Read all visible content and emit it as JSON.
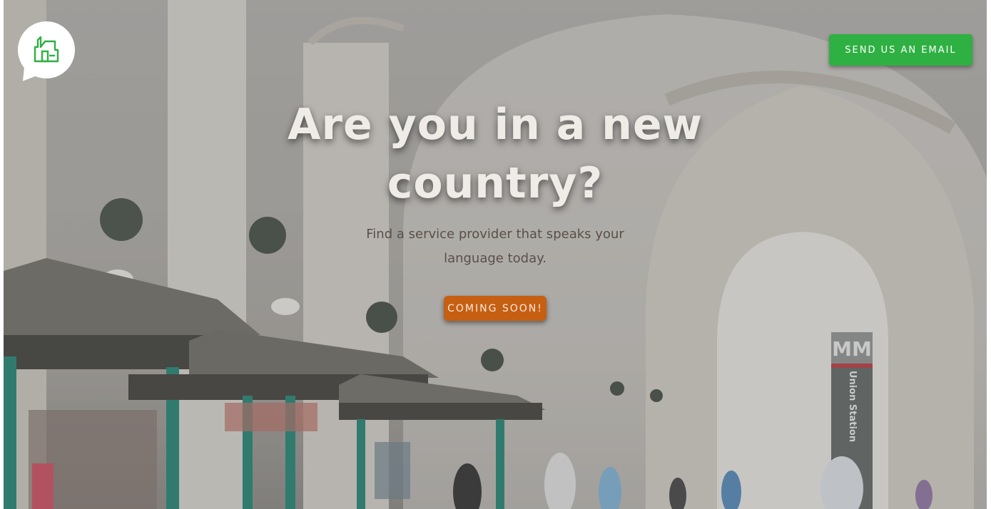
{
  "header": {
    "logo_icon": "house-speech-bubble-icon",
    "email_button_label": "SEND US AN EMAIL"
  },
  "hero": {
    "headline": "Are you in a new country?",
    "subtitle": "Find a service provider that speaks your language today.",
    "cta_label": "COMING SOON!",
    "background_image": "train-station-arches-with-kiosks",
    "sign_text": "Union Station"
  },
  "colors": {
    "email_button": "#2fb043",
    "cta_button": "#c65f12",
    "logo_accent": "#2fb043",
    "headline": "#efece8"
  }
}
